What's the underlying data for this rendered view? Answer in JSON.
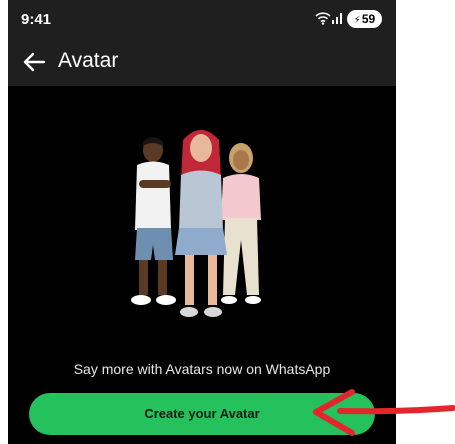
{
  "status_bar": {
    "time": "9:41",
    "battery": "59",
    "icons": [
      "wifi-icon",
      "signal-icon",
      "battery-charging-icon"
    ]
  },
  "app_bar": {
    "title": "Avatar",
    "back_icon": "arrow-left-icon"
  },
  "main": {
    "tagline": "Say more with Avatars now on WhatsApp",
    "create_button_label": "Create your Avatar",
    "illustration": "three-avatars-illustration"
  },
  "annotation": {
    "icon": "red-arrow-pointer",
    "color": "#e3262b"
  },
  "colors": {
    "background": "#000000",
    "bar": "#1f1f1f",
    "accent": "#25c15c"
  }
}
